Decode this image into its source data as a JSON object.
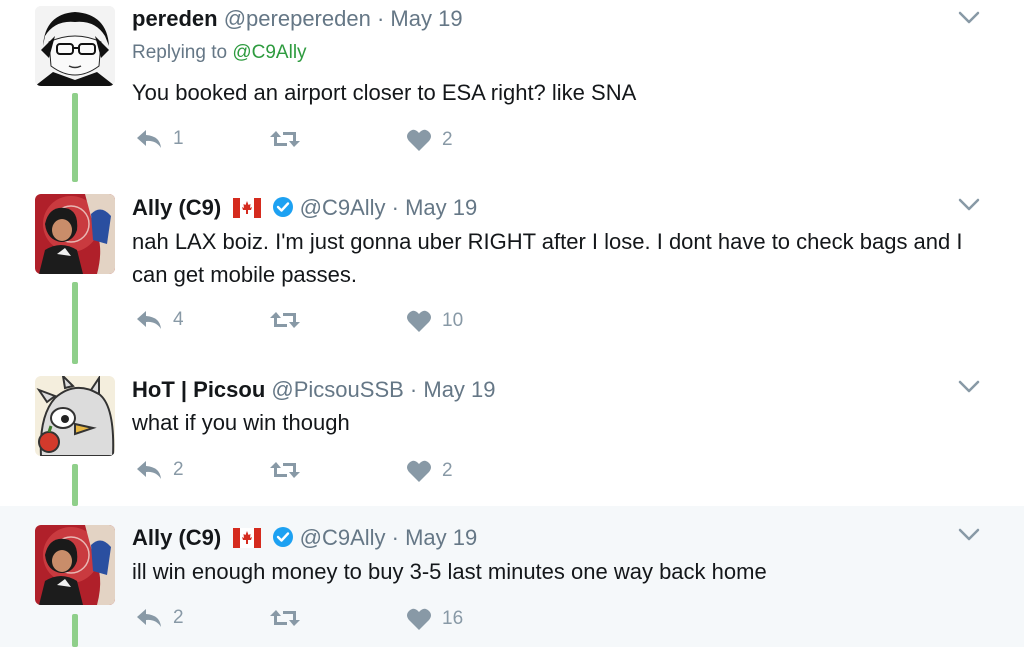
{
  "tweets": [
    {
      "name": "pereden",
      "handle": "@perepereden",
      "sep": "·",
      "date": "May 19",
      "replying_prefix": "Replying to",
      "replying_to": "@C9Ally",
      "text": "You booked an airport closer to ESA right? like SNA",
      "replies": "1",
      "retweets": "",
      "likes": "2",
      "flag": false,
      "verified": false,
      "highlighted": false,
      "avatar": "anime-glasses-avatar"
    },
    {
      "name": "Ally (C9)",
      "handle": "@C9Ally",
      "sep": "·",
      "date": "May 19",
      "text": "nah LAX boiz. I'm just gonna uber RIGHT after I lose. I dont have to check bags and I can get mobile passes.",
      "replies": "4",
      "retweets": "",
      "likes": "10",
      "flag": true,
      "verified": true,
      "highlighted": false,
      "avatar": "ally-illustrated-avatar"
    },
    {
      "name": "HoT | Picsou",
      "handle": "@PicsouSSB",
      "sep": "·",
      "date": "May 19",
      "text": "what if you win though",
      "replies": "2",
      "retweets": "",
      "likes": "2",
      "flag": false,
      "verified": false,
      "highlighted": false,
      "avatar": "cartoon-bird-avatar"
    },
    {
      "name": "Ally (C9)",
      "handle": "@C9Ally",
      "sep": "·",
      "date": "May 19",
      "text": "ill win enough money to buy 3-5 last minutes one way back home",
      "replies": "2",
      "retweets": "",
      "likes": "16",
      "flag": true,
      "verified": true,
      "highlighted": true,
      "avatar": "ally-illustrated-avatar"
    }
  ],
  "colors": {
    "thread_line": "#8fcf8a",
    "action_gray": "#8899a6",
    "verified_blue": "#1da1f2",
    "mention_green": "#2e9b3f",
    "highlight_bg": "#f5f8fa"
  },
  "icons": [
    "reply-icon",
    "retweet-icon",
    "like-icon",
    "chevron-down-icon",
    "verified-badge-icon",
    "canada-flag-icon"
  ]
}
